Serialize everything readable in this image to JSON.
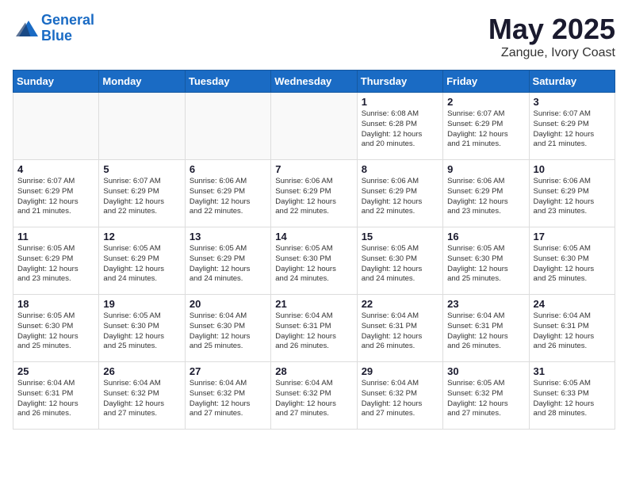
{
  "logo": {
    "line1": "General",
    "line2": "Blue"
  },
  "title": "May 2025",
  "subtitle": "Zangue, Ivory Coast",
  "weekdays": [
    "Sunday",
    "Monday",
    "Tuesday",
    "Wednesday",
    "Thursday",
    "Friday",
    "Saturday"
  ],
  "weeks": [
    [
      {
        "day": "",
        "info": ""
      },
      {
        "day": "",
        "info": ""
      },
      {
        "day": "",
        "info": ""
      },
      {
        "day": "",
        "info": ""
      },
      {
        "day": "1",
        "info": "Sunrise: 6:08 AM\nSunset: 6:28 PM\nDaylight: 12 hours\nand 20 minutes."
      },
      {
        "day": "2",
        "info": "Sunrise: 6:07 AM\nSunset: 6:29 PM\nDaylight: 12 hours\nand 21 minutes."
      },
      {
        "day": "3",
        "info": "Sunrise: 6:07 AM\nSunset: 6:29 PM\nDaylight: 12 hours\nand 21 minutes."
      }
    ],
    [
      {
        "day": "4",
        "info": "Sunrise: 6:07 AM\nSunset: 6:29 PM\nDaylight: 12 hours\nand 21 minutes."
      },
      {
        "day": "5",
        "info": "Sunrise: 6:07 AM\nSunset: 6:29 PM\nDaylight: 12 hours\nand 22 minutes."
      },
      {
        "day": "6",
        "info": "Sunrise: 6:06 AM\nSunset: 6:29 PM\nDaylight: 12 hours\nand 22 minutes."
      },
      {
        "day": "7",
        "info": "Sunrise: 6:06 AM\nSunset: 6:29 PM\nDaylight: 12 hours\nand 22 minutes."
      },
      {
        "day": "8",
        "info": "Sunrise: 6:06 AM\nSunset: 6:29 PM\nDaylight: 12 hours\nand 22 minutes."
      },
      {
        "day": "9",
        "info": "Sunrise: 6:06 AM\nSunset: 6:29 PM\nDaylight: 12 hours\nand 23 minutes."
      },
      {
        "day": "10",
        "info": "Sunrise: 6:06 AM\nSunset: 6:29 PM\nDaylight: 12 hours\nand 23 minutes."
      }
    ],
    [
      {
        "day": "11",
        "info": "Sunrise: 6:05 AM\nSunset: 6:29 PM\nDaylight: 12 hours\nand 23 minutes."
      },
      {
        "day": "12",
        "info": "Sunrise: 6:05 AM\nSunset: 6:29 PM\nDaylight: 12 hours\nand 24 minutes."
      },
      {
        "day": "13",
        "info": "Sunrise: 6:05 AM\nSunset: 6:29 PM\nDaylight: 12 hours\nand 24 minutes."
      },
      {
        "day": "14",
        "info": "Sunrise: 6:05 AM\nSunset: 6:30 PM\nDaylight: 12 hours\nand 24 minutes."
      },
      {
        "day": "15",
        "info": "Sunrise: 6:05 AM\nSunset: 6:30 PM\nDaylight: 12 hours\nand 24 minutes."
      },
      {
        "day": "16",
        "info": "Sunrise: 6:05 AM\nSunset: 6:30 PM\nDaylight: 12 hours\nand 25 minutes."
      },
      {
        "day": "17",
        "info": "Sunrise: 6:05 AM\nSunset: 6:30 PM\nDaylight: 12 hours\nand 25 minutes."
      }
    ],
    [
      {
        "day": "18",
        "info": "Sunrise: 6:05 AM\nSunset: 6:30 PM\nDaylight: 12 hours\nand 25 minutes."
      },
      {
        "day": "19",
        "info": "Sunrise: 6:05 AM\nSunset: 6:30 PM\nDaylight: 12 hours\nand 25 minutes."
      },
      {
        "day": "20",
        "info": "Sunrise: 6:04 AM\nSunset: 6:30 PM\nDaylight: 12 hours\nand 25 minutes."
      },
      {
        "day": "21",
        "info": "Sunrise: 6:04 AM\nSunset: 6:31 PM\nDaylight: 12 hours\nand 26 minutes."
      },
      {
        "day": "22",
        "info": "Sunrise: 6:04 AM\nSunset: 6:31 PM\nDaylight: 12 hours\nand 26 minutes."
      },
      {
        "day": "23",
        "info": "Sunrise: 6:04 AM\nSunset: 6:31 PM\nDaylight: 12 hours\nand 26 minutes."
      },
      {
        "day": "24",
        "info": "Sunrise: 6:04 AM\nSunset: 6:31 PM\nDaylight: 12 hours\nand 26 minutes."
      }
    ],
    [
      {
        "day": "25",
        "info": "Sunrise: 6:04 AM\nSunset: 6:31 PM\nDaylight: 12 hours\nand 26 minutes."
      },
      {
        "day": "26",
        "info": "Sunrise: 6:04 AM\nSunset: 6:32 PM\nDaylight: 12 hours\nand 27 minutes."
      },
      {
        "day": "27",
        "info": "Sunrise: 6:04 AM\nSunset: 6:32 PM\nDaylight: 12 hours\nand 27 minutes."
      },
      {
        "day": "28",
        "info": "Sunrise: 6:04 AM\nSunset: 6:32 PM\nDaylight: 12 hours\nand 27 minutes."
      },
      {
        "day": "29",
        "info": "Sunrise: 6:04 AM\nSunset: 6:32 PM\nDaylight: 12 hours\nand 27 minutes."
      },
      {
        "day": "30",
        "info": "Sunrise: 6:05 AM\nSunset: 6:32 PM\nDaylight: 12 hours\nand 27 minutes."
      },
      {
        "day": "31",
        "info": "Sunrise: 6:05 AM\nSunset: 6:33 PM\nDaylight: 12 hours\nand 28 minutes."
      }
    ]
  ]
}
